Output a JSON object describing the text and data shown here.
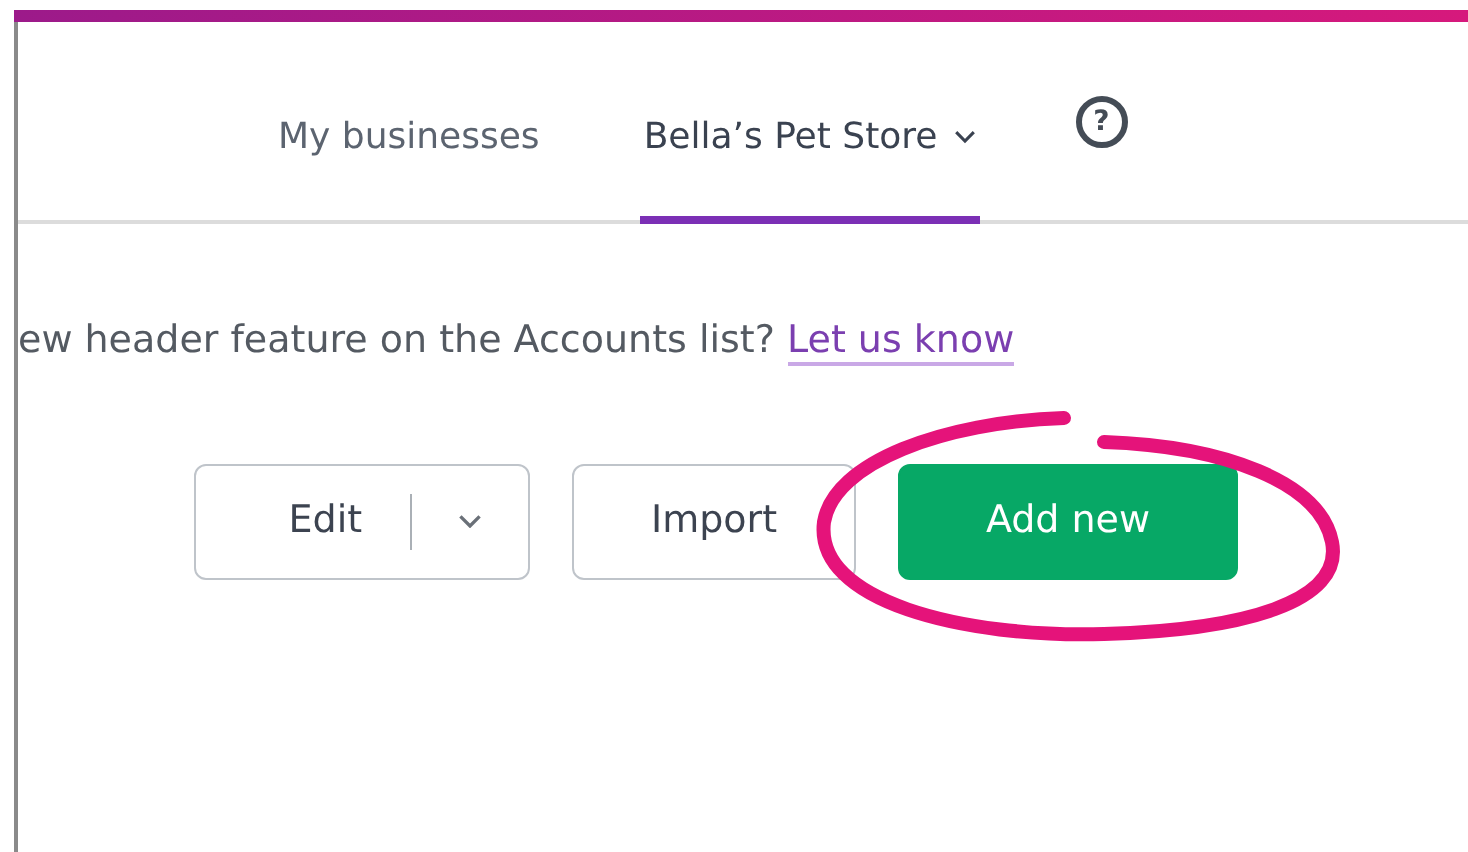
{
  "nav": {
    "tabs": [
      {
        "label": "My businesses",
        "selected": false,
        "dropdown": false
      },
      {
        "label": "Bella’s Pet Store",
        "selected": true,
        "dropdown": true
      }
    ],
    "help": {
      "icon": "?"
    }
  },
  "feedback": {
    "text": "ew header feature on the Accounts list?",
    "link": "Let us know"
  },
  "buttons": [
    {
      "kind": "split",
      "label": "Edit"
    },
    {
      "kind": "outline",
      "label": "Import"
    },
    {
      "kind": "primary",
      "label": "Add new",
      "highlighted": true
    }
  ]
}
